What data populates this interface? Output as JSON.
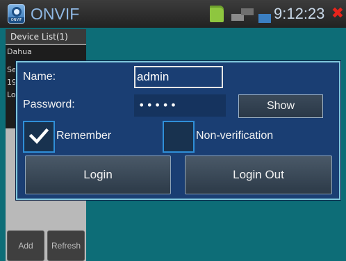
{
  "app": {
    "title": "ONVIF",
    "icon_caption": "ONVIF",
    "clock": "9:12:23",
    "close_symbol": "✖"
  },
  "status_icons": [
    "sd-card-icon",
    "network-icon",
    "battery-icon"
  ],
  "device_panel": {
    "header": "Device List(1)",
    "rows": [
      "Dahua",
      "Se",
      "19",
      "Lo"
    ],
    "add_label": "Add",
    "refresh_label": "Refresh"
  },
  "login": {
    "name_label": "Name:",
    "name_value": "admin",
    "password_label": "Password:",
    "password_mask": "•••••",
    "show_label": "Show",
    "remember_label": "Remember",
    "remember_checked": true,
    "nonverification_label": "Non-verification",
    "nonverification_checked": false,
    "login_label": "Login",
    "logout_label": "Login Out"
  },
  "colors": {
    "background": "#0d6d77",
    "dialog": "#1a3e73",
    "dialog_border": "#7fc6dc",
    "close": "#e8241c",
    "checkbox_border": "#2f8fd8"
  }
}
